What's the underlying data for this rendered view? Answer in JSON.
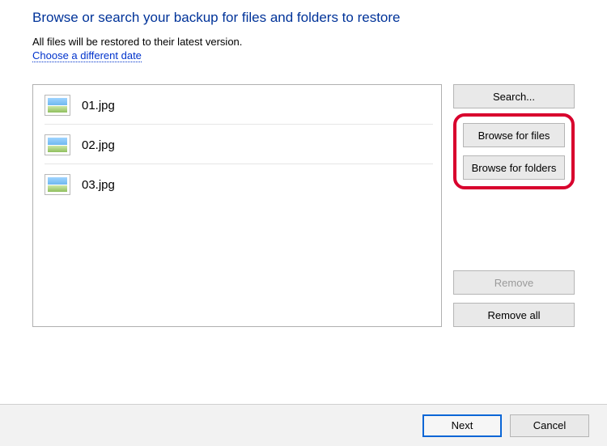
{
  "heading": "Browse or search your backup for files and folders to restore",
  "subtext": "All files will be restored to their latest version.",
  "link": "Choose a different date",
  "files": [
    {
      "name": "01.jpg"
    },
    {
      "name": "02.jpg"
    },
    {
      "name": "03.jpg"
    }
  ],
  "side": {
    "search": "Search...",
    "browse_files": "Browse for files",
    "browse_folders": "Browse for folders",
    "remove": "Remove",
    "remove_all": "Remove all"
  },
  "footer": {
    "next": "Next",
    "cancel": "Cancel"
  }
}
